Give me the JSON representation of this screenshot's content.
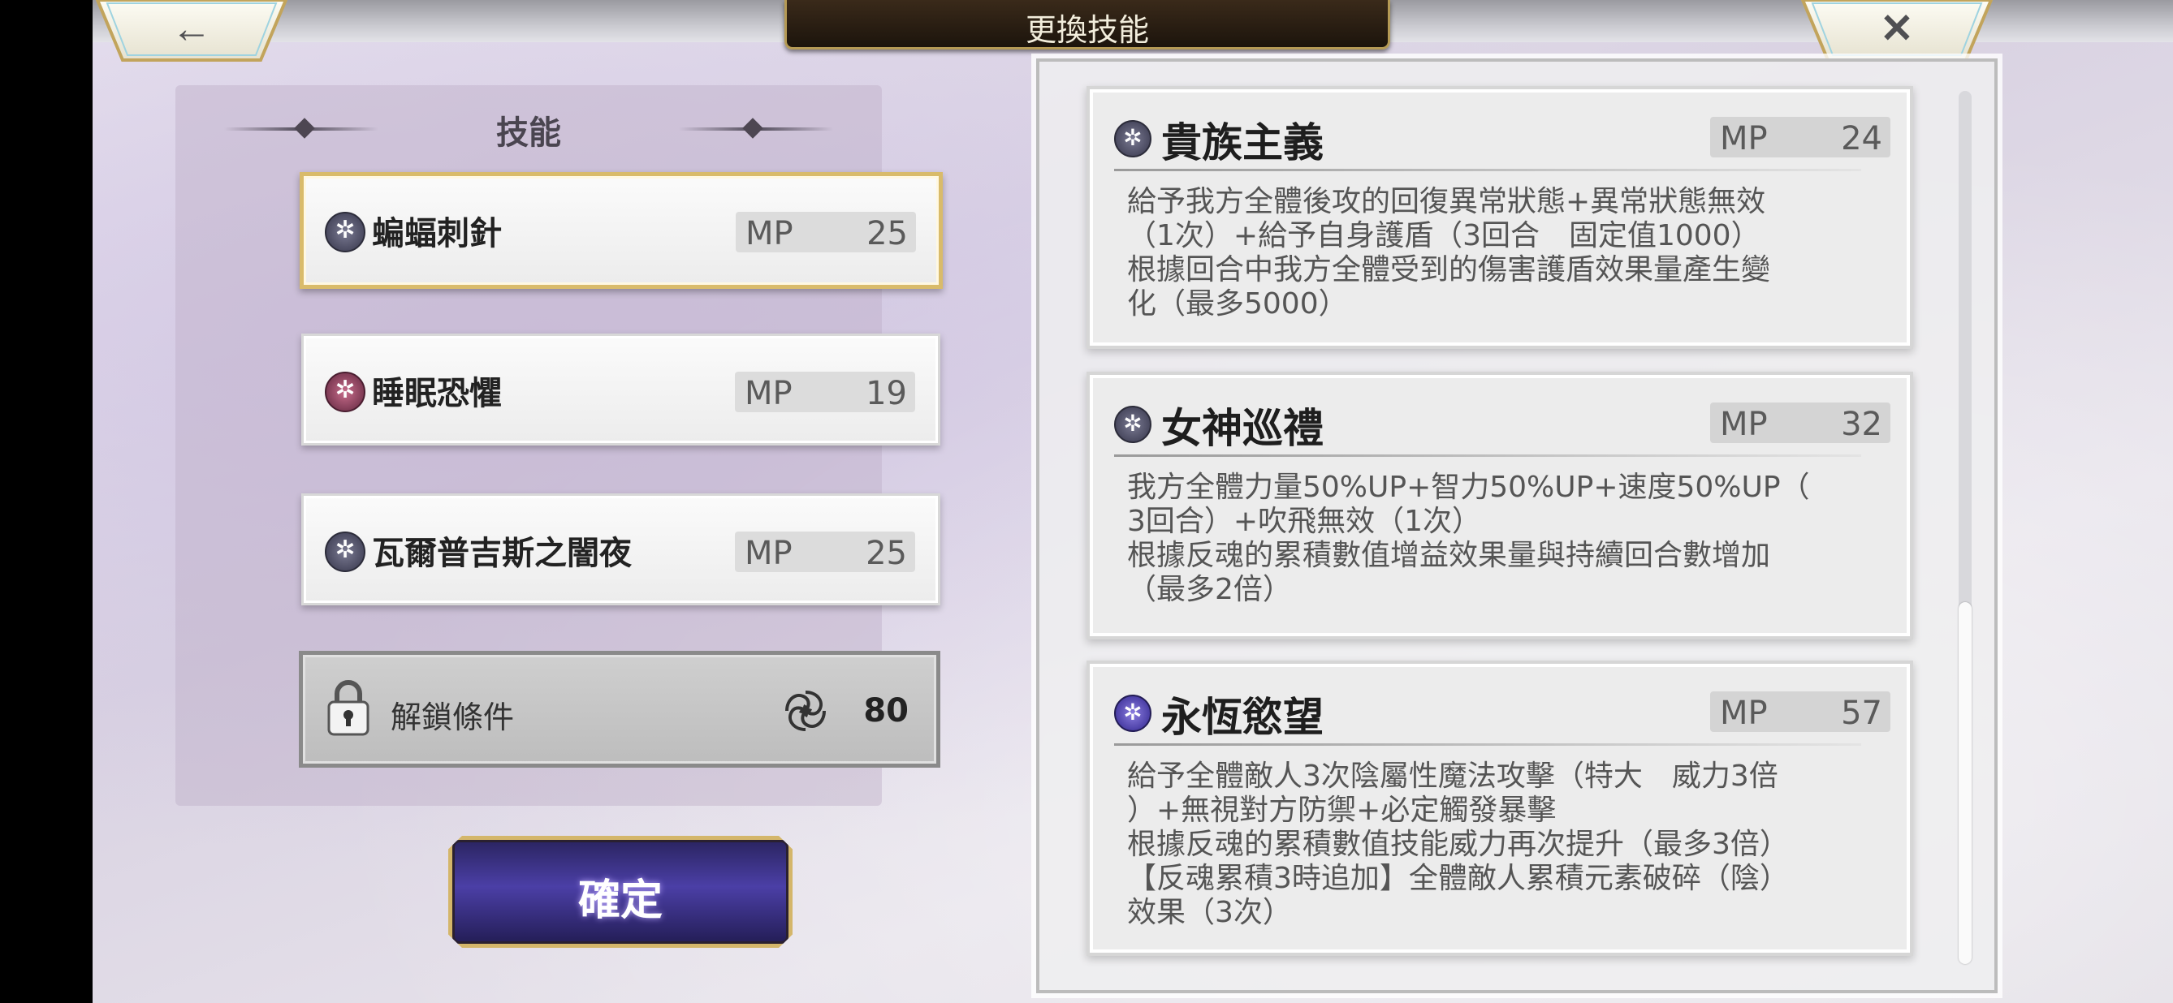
{
  "header": {
    "title": "更換技能",
    "back_icon": "←",
    "close_icon": "✕"
  },
  "left_panel": {
    "title": "技能",
    "slots": [
      {
        "name": "蝙蝠刺針",
        "mp_label": "MP",
        "mp": "25",
        "icon": "dark-skill-icon",
        "selected": true
      },
      {
        "name": "睡眠恐懼",
        "mp_label": "MP",
        "mp": "19",
        "icon": "pink-skill-icon",
        "selected": false
      },
      {
        "name": "瓦爾普吉斯之闇夜",
        "mp_label": "MP",
        "mp": "25",
        "icon": "dark-skill-icon",
        "selected": false
      }
    ],
    "locked_slot": {
      "label": "解鎖條件",
      "value": "80",
      "icon": "soul-swirl-icon"
    }
  },
  "confirm_label": "確定",
  "skill_cards": [
    {
      "name": "貴族主義",
      "mp_label": "MP",
      "mp": "24",
      "description": "給予我方全體後攻的回復異常狀態+異常狀態無效\n（1次）+給予自身護盾（3回合　固定值1000）\n根據回合中我方全體受到的傷害護盾效果量產生變\n化（最多5000）"
    },
    {
      "name": "女神巡禮",
      "mp_label": "MP",
      "mp": "32",
      "description": "我方全體力量50%UP+智力50%UP+速度50%UP（\n3回合）+吹飛無效（1次）\n根據反魂的累積數值增益效果量與持續回合數增加\n（最多2倍）"
    },
    {
      "name": "永恆慾望",
      "mp_label": "MP",
      "mp": "57",
      "description": "給予全體敵人3次陰屬性魔法攻擊（特大　威力3倍\n）+無視對方防禦+必定觸發暴擊\n根據反魂的累積數值技能威力再次提升（最多3倍）\n【反魂累積3時追加】全體敵人累積元素破碎（陰）\n效果（3次）"
    }
  ],
  "colors": {
    "gold_border": "#d9bb6a",
    "confirm_purple": "#4b3fa6",
    "title_plate": "#1c140c"
  }
}
